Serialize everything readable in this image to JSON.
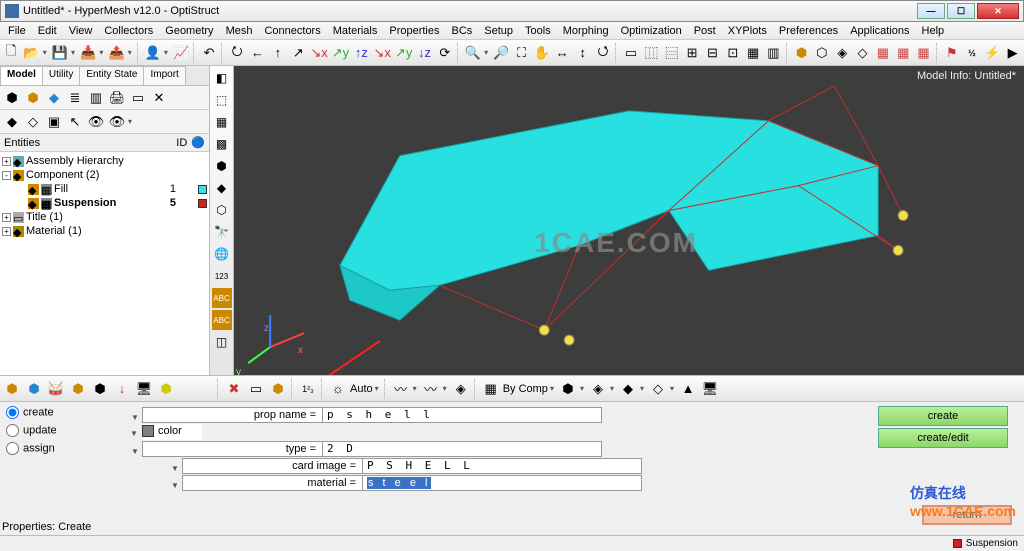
{
  "title": "Untitled* - HyperMesh v12.0 - OptiStruct",
  "menus": [
    "File",
    "Edit",
    "View",
    "Collectors",
    "Geometry",
    "Mesh",
    "Connectors",
    "Materials",
    "Properties",
    "BCs",
    "Setup",
    "Tools",
    "Morphing",
    "Optimization",
    "Post",
    "XYPlots",
    "Preferences",
    "Applications",
    "Help"
  ],
  "sidebar": {
    "tabs": [
      "Model",
      "Utility",
      "Entity State",
      "Import"
    ],
    "activeTab": 0,
    "head": {
      "entities": "Entities",
      "id": "ID"
    },
    "tree": {
      "assembly": {
        "label": "Assembly Hierarchy"
      },
      "component": {
        "label": "Component (2)",
        "children": [
          {
            "name": "Fill",
            "id": "1",
            "color": "#32e6e6"
          },
          {
            "name": "Suspension",
            "id": "5",
            "color": "#d02020",
            "bold": true
          }
        ]
      },
      "title": {
        "label": "Title (1)"
      },
      "material": {
        "label": "Material (1)"
      }
    }
  },
  "viewport": {
    "info": "Model Info: Untitled*"
  },
  "watermark": "1CAE.COM",
  "watermark2_cn": "仿真在线",
  "watermark2_url": "www.1CAE.com",
  "panel": {
    "radios": {
      "create": "create",
      "update": "update",
      "assign": "assign"
    },
    "fields": {
      "propname": {
        "label": "prop name =",
        "value": "p s h e l l"
      },
      "color": {
        "label": "color",
        "sw": "#808080"
      },
      "type": {
        "label": "type =",
        "value": "2 D"
      },
      "card": {
        "label": "card image =",
        "value": "P S H E L L"
      },
      "material": {
        "label": "material =",
        "value": "s t e e l",
        "hl": true
      }
    },
    "buttons": {
      "create": "create",
      "createedit": "create/edit",
      "return": "return"
    }
  },
  "status": {
    "left": "Properties: Create",
    "right_label": "Suspension",
    "right_sw": "#d02020"
  },
  "auto_label": "Auto",
  "bycomp_label": "By Comp",
  "axis": {
    "x": "x",
    "y": "y",
    "z": "z"
  }
}
